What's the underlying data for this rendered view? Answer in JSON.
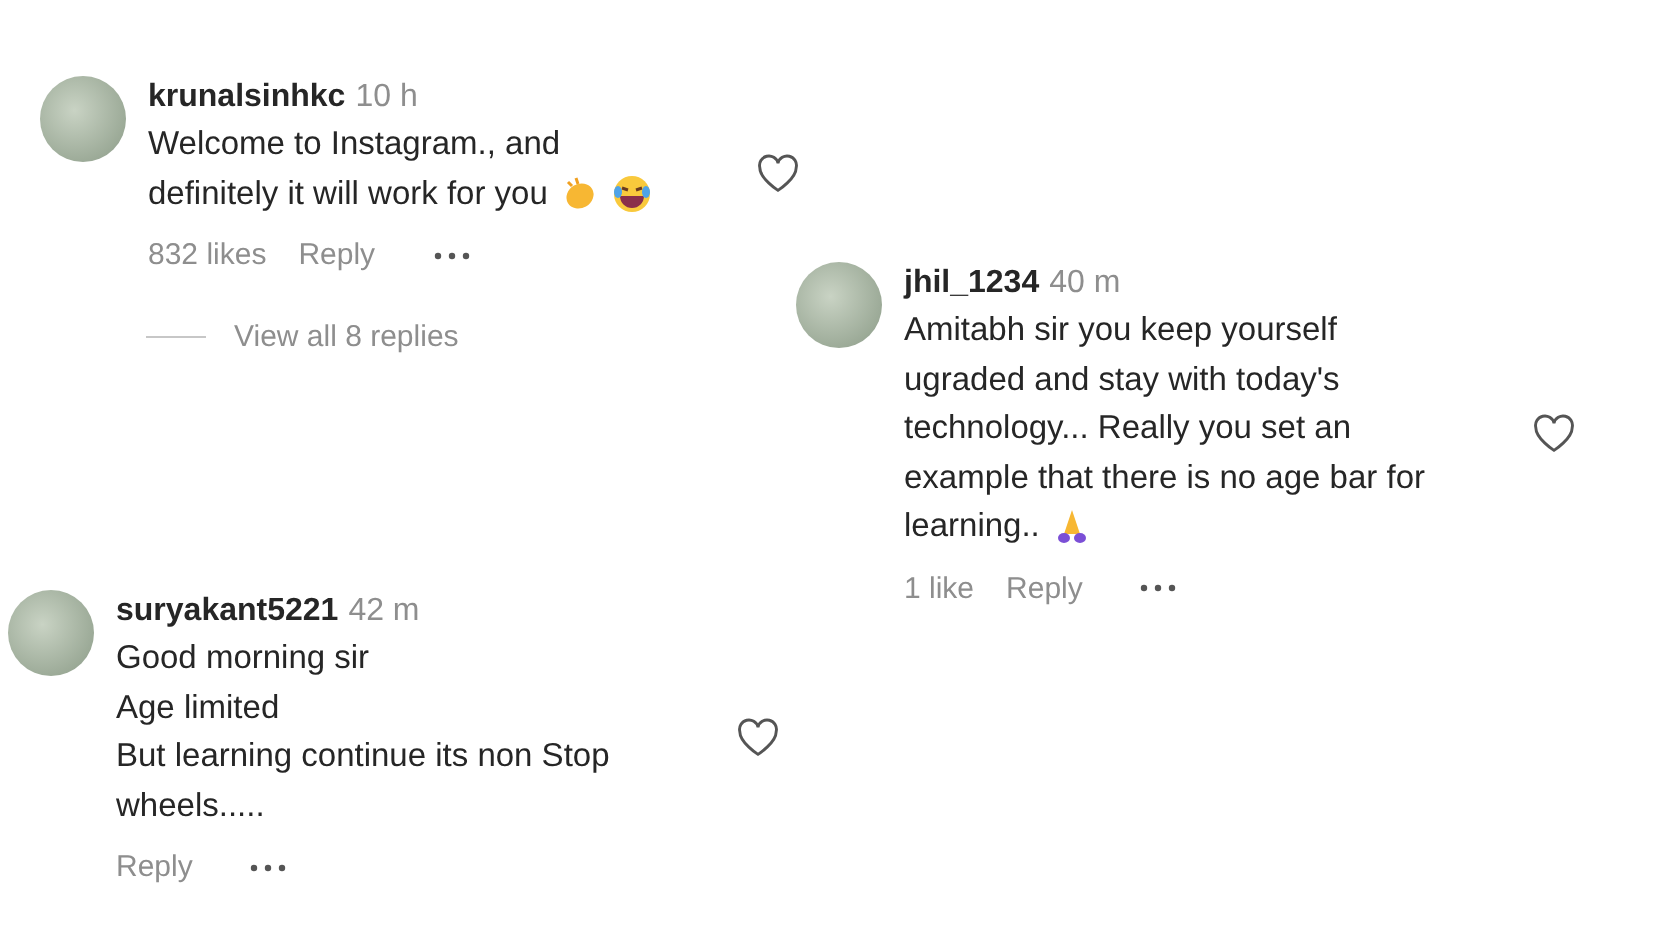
{
  "comments": [
    {
      "username": "krunalsinhkc",
      "time": "10 h",
      "lines": [
        "Welcome to Instagram., and",
        "definitely it will work for you"
      ],
      "emojis": [
        {
          "kind": "clap"
        },
        {
          "kind": "laugh"
        }
      ],
      "likes": "832 likes",
      "reply": "Reply",
      "liked": false,
      "view_replies": "View all 8 replies"
    },
    {
      "username": "jhil_1234",
      "time": "40 m",
      "lines": [
        "Amitabh sir you keep yourself",
        "ugraded and stay with today's",
        "technology... Really you set an",
        "example that there is no age bar for",
        "learning.."
      ],
      "emojis": [
        {
          "kind": "pray"
        }
      ],
      "likes": "1 like",
      "reply": "Reply",
      "liked": false
    },
    {
      "username": "suryakant5221",
      "time": "42 m",
      "lines": [
        "Good morning sir",
        "Age limited",
        "But learning continue its non Stop",
        "wheels....."
      ],
      "reply": "Reply",
      "liked": false
    }
  ]
}
